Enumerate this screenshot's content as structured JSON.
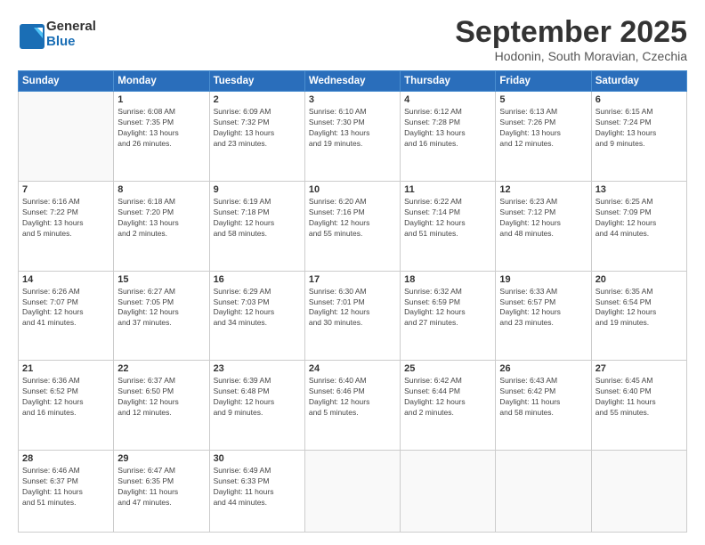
{
  "logo": {
    "line1": "General",
    "line2": "Blue"
  },
  "title": "September 2025",
  "subtitle": "Hodonin, South Moravian, Czechia",
  "header_days": [
    "Sunday",
    "Monday",
    "Tuesday",
    "Wednesday",
    "Thursday",
    "Friday",
    "Saturday"
  ],
  "weeks": [
    [
      {
        "day": "",
        "info": ""
      },
      {
        "day": "1",
        "info": "Sunrise: 6:08 AM\nSunset: 7:35 PM\nDaylight: 13 hours\nand 26 minutes."
      },
      {
        "day": "2",
        "info": "Sunrise: 6:09 AM\nSunset: 7:32 PM\nDaylight: 13 hours\nand 23 minutes."
      },
      {
        "day": "3",
        "info": "Sunrise: 6:10 AM\nSunset: 7:30 PM\nDaylight: 13 hours\nand 19 minutes."
      },
      {
        "day": "4",
        "info": "Sunrise: 6:12 AM\nSunset: 7:28 PM\nDaylight: 13 hours\nand 16 minutes."
      },
      {
        "day": "5",
        "info": "Sunrise: 6:13 AM\nSunset: 7:26 PM\nDaylight: 13 hours\nand 12 minutes."
      },
      {
        "day": "6",
        "info": "Sunrise: 6:15 AM\nSunset: 7:24 PM\nDaylight: 13 hours\nand 9 minutes."
      }
    ],
    [
      {
        "day": "7",
        "info": "Sunrise: 6:16 AM\nSunset: 7:22 PM\nDaylight: 13 hours\nand 5 minutes."
      },
      {
        "day": "8",
        "info": "Sunrise: 6:18 AM\nSunset: 7:20 PM\nDaylight: 13 hours\nand 2 minutes."
      },
      {
        "day": "9",
        "info": "Sunrise: 6:19 AM\nSunset: 7:18 PM\nDaylight: 12 hours\nand 58 minutes."
      },
      {
        "day": "10",
        "info": "Sunrise: 6:20 AM\nSunset: 7:16 PM\nDaylight: 12 hours\nand 55 minutes."
      },
      {
        "day": "11",
        "info": "Sunrise: 6:22 AM\nSunset: 7:14 PM\nDaylight: 12 hours\nand 51 minutes."
      },
      {
        "day": "12",
        "info": "Sunrise: 6:23 AM\nSunset: 7:12 PM\nDaylight: 12 hours\nand 48 minutes."
      },
      {
        "day": "13",
        "info": "Sunrise: 6:25 AM\nSunset: 7:09 PM\nDaylight: 12 hours\nand 44 minutes."
      }
    ],
    [
      {
        "day": "14",
        "info": "Sunrise: 6:26 AM\nSunset: 7:07 PM\nDaylight: 12 hours\nand 41 minutes."
      },
      {
        "day": "15",
        "info": "Sunrise: 6:27 AM\nSunset: 7:05 PM\nDaylight: 12 hours\nand 37 minutes."
      },
      {
        "day": "16",
        "info": "Sunrise: 6:29 AM\nSunset: 7:03 PM\nDaylight: 12 hours\nand 34 minutes."
      },
      {
        "day": "17",
        "info": "Sunrise: 6:30 AM\nSunset: 7:01 PM\nDaylight: 12 hours\nand 30 minutes."
      },
      {
        "day": "18",
        "info": "Sunrise: 6:32 AM\nSunset: 6:59 PM\nDaylight: 12 hours\nand 27 minutes."
      },
      {
        "day": "19",
        "info": "Sunrise: 6:33 AM\nSunset: 6:57 PM\nDaylight: 12 hours\nand 23 minutes."
      },
      {
        "day": "20",
        "info": "Sunrise: 6:35 AM\nSunset: 6:54 PM\nDaylight: 12 hours\nand 19 minutes."
      }
    ],
    [
      {
        "day": "21",
        "info": "Sunrise: 6:36 AM\nSunset: 6:52 PM\nDaylight: 12 hours\nand 16 minutes."
      },
      {
        "day": "22",
        "info": "Sunrise: 6:37 AM\nSunset: 6:50 PM\nDaylight: 12 hours\nand 12 minutes."
      },
      {
        "day": "23",
        "info": "Sunrise: 6:39 AM\nSunset: 6:48 PM\nDaylight: 12 hours\nand 9 minutes."
      },
      {
        "day": "24",
        "info": "Sunrise: 6:40 AM\nSunset: 6:46 PM\nDaylight: 12 hours\nand 5 minutes."
      },
      {
        "day": "25",
        "info": "Sunrise: 6:42 AM\nSunset: 6:44 PM\nDaylight: 12 hours\nand 2 minutes."
      },
      {
        "day": "26",
        "info": "Sunrise: 6:43 AM\nSunset: 6:42 PM\nDaylight: 11 hours\nand 58 minutes."
      },
      {
        "day": "27",
        "info": "Sunrise: 6:45 AM\nSunset: 6:40 PM\nDaylight: 11 hours\nand 55 minutes."
      }
    ],
    [
      {
        "day": "28",
        "info": "Sunrise: 6:46 AM\nSunset: 6:37 PM\nDaylight: 11 hours\nand 51 minutes."
      },
      {
        "day": "29",
        "info": "Sunrise: 6:47 AM\nSunset: 6:35 PM\nDaylight: 11 hours\nand 47 minutes."
      },
      {
        "day": "30",
        "info": "Sunrise: 6:49 AM\nSunset: 6:33 PM\nDaylight: 11 hours\nand 44 minutes."
      },
      {
        "day": "",
        "info": ""
      },
      {
        "day": "",
        "info": ""
      },
      {
        "day": "",
        "info": ""
      },
      {
        "day": "",
        "info": ""
      }
    ]
  ]
}
